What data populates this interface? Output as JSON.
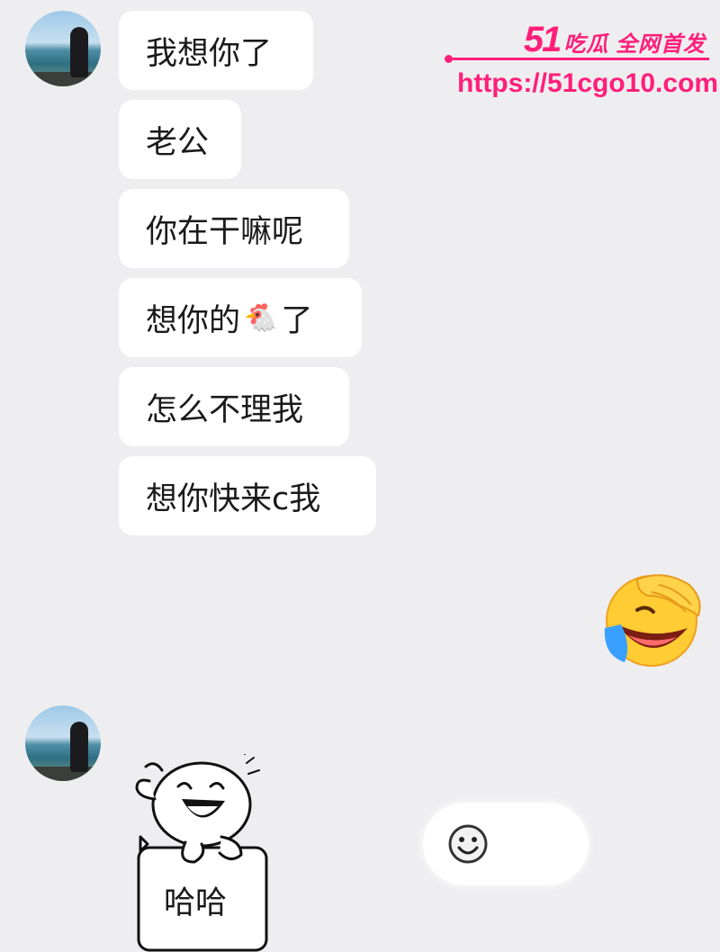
{
  "messages": [
    {
      "text": "我想你了"
    },
    {
      "text": "老公"
    },
    {
      "text": "你在干嘛呢"
    },
    {
      "text_before": "想你的",
      "emoji": "🐔",
      "text_after": "了"
    },
    {
      "text": "怎么不理我"
    },
    {
      "text": "想你快来c我"
    }
  ],
  "sticker": {
    "caption": "哈哈"
  },
  "watermark": {
    "brand_num": "51",
    "brand_text": "吃瓜 全网首发",
    "url": "https://51cgo10.com"
  },
  "colors": {
    "background": "#eeeef0",
    "bubble": "#ffffff",
    "watermark": "#ff1f7a"
  },
  "icons": [
    "avatar-photo",
    "laughing-crying-emoji",
    "laughing-blob-sticker",
    "smiley-icon"
  ]
}
